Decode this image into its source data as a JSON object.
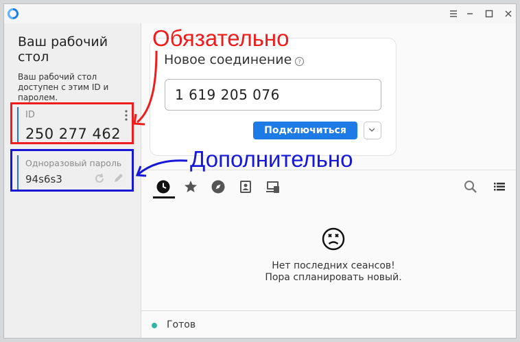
{
  "left_panel": {
    "title": "Ваш рабочий стол",
    "description": "Ваш рабочий стол доступен с этим ID и паролем.",
    "id_label": "ID",
    "id_value": "250 277 462",
    "password_label": "Одноразовый пароль",
    "password_value": "94s6s3"
  },
  "new_connection": {
    "title": "Новое соединение",
    "input_value": "1 619 205 076",
    "connect_button": "Подключиться"
  },
  "annotations": {
    "required": "Обязательно",
    "optional": "Дополнительно",
    "required_color": "#ee1c1c",
    "optional_color": "#1618d6"
  },
  "tabs": [
    "clock-icon",
    "star-icon",
    "compass-icon",
    "address-book-icon",
    "devices-icon"
  ],
  "toolbar_icons": [
    "search-icon",
    "list-view-icon"
  ],
  "empty_state": {
    "icon": "sad-face-icon",
    "line1": "Нет последних сеансов!",
    "line2": "Пора спланировать новый."
  },
  "status": {
    "text": "Готов",
    "color": "#2fb5a0"
  },
  "colors": {
    "accent": "#1e7be6"
  }
}
